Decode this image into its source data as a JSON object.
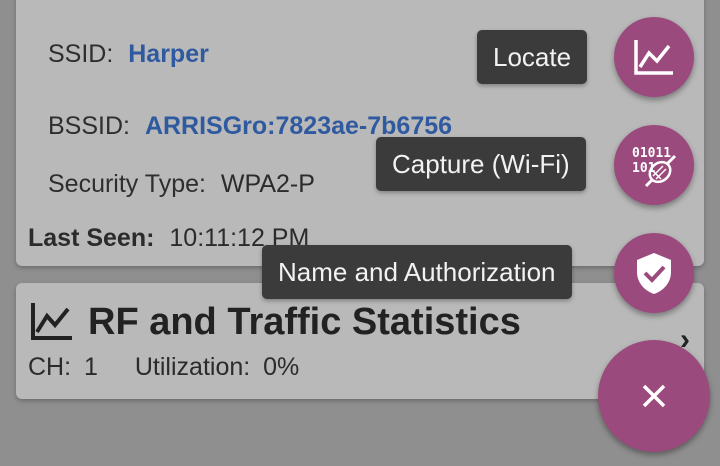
{
  "network": {
    "ssid_label": "SSID:",
    "ssid_value": "Harper",
    "bssid_label": "BSSID:",
    "bssid_value": "ARRISGro:7823ae-7b6756",
    "security_label": "Security Type:",
    "security_value": "WPA2-P",
    "last_seen_label": "Last Seen:",
    "last_seen_value": "10:11:12 PM"
  },
  "stats_card": {
    "title": "RF and Traffic Statistics",
    "ch_label": "CH:",
    "ch_value": "1",
    "util_label": "Utilization:",
    "util_value": "0%"
  },
  "speed_dial": {
    "locate_label": "Locate",
    "capture_label": "Capture (Wi-Fi)",
    "name_auth_label": "Name and Authorization",
    "icons": [
      "chart-icon",
      "binary-capture-icon",
      "shield-check-icon",
      "close-icon"
    ],
    "accent_color": "#9b4a7d"
  }
}
